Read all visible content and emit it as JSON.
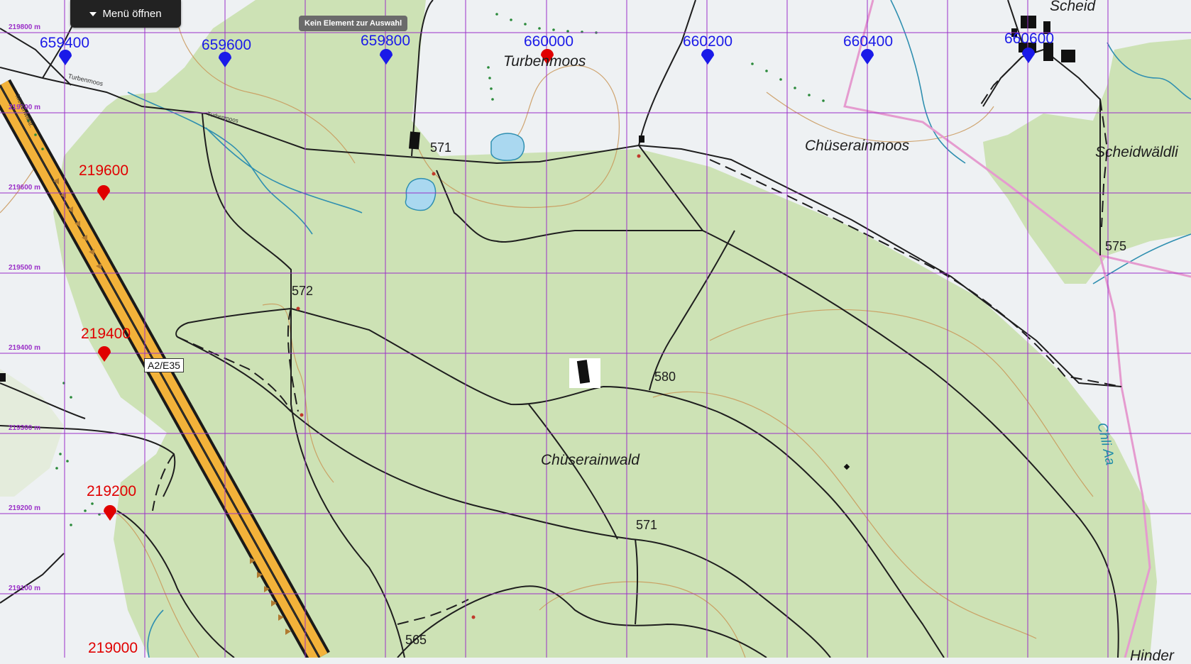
{
  "menu": {
    "label": "Menü öffnen"
  },
  "selection_hint": "Kein Element zur Auswahl",
  "grid": {
    "easting_labels": [
      "659400",
      "659600",
      "659800",
      "660000",
      "660200",
      "660400",
      "660600"
    ],
    "northing_labels": [
      "219600",
      "219400",
      "219200",
      "219000"
    ],
    "northing_axis_labels": [
      "219800 m",
      "219700 m",
      "219600 m",
      "219500 m",
      "219400 m",
      "219300 m",
      "219200 m",
      "219100 m"
    ],
    "selected_easting": "660000",
    "colors": {
      "easting_marker": "#1a1ae8",
      "northing_marker": "#e00000",
      "grid_line": "#9b30c8"
    }
  },
  "place_names": {
    "turbenmoos": "Turbenmoos",
    "chuserainmoos": "Chüserainmoos",
    "scheidwaldli": "Scheidwäldli",
    "chuserainwald": "Chüserainwald",
    "scheid": "Scheid",
    "hinder": "Hinder"
  },
  "road_names": {
    "turbenmoos_road_1": "Turbenmoos",
    "turbenmoos_road_2": "Turbenmoos",
    "mettmenstr": "Mettenwilstr."
  },
  "spot_heights": [
    "571",
    "572",
    "580",
    "571",
    "575",
    "565"
  ],
  "motorway_shield": "A2/E35",
  "water_name": "Chli Aa"
}
